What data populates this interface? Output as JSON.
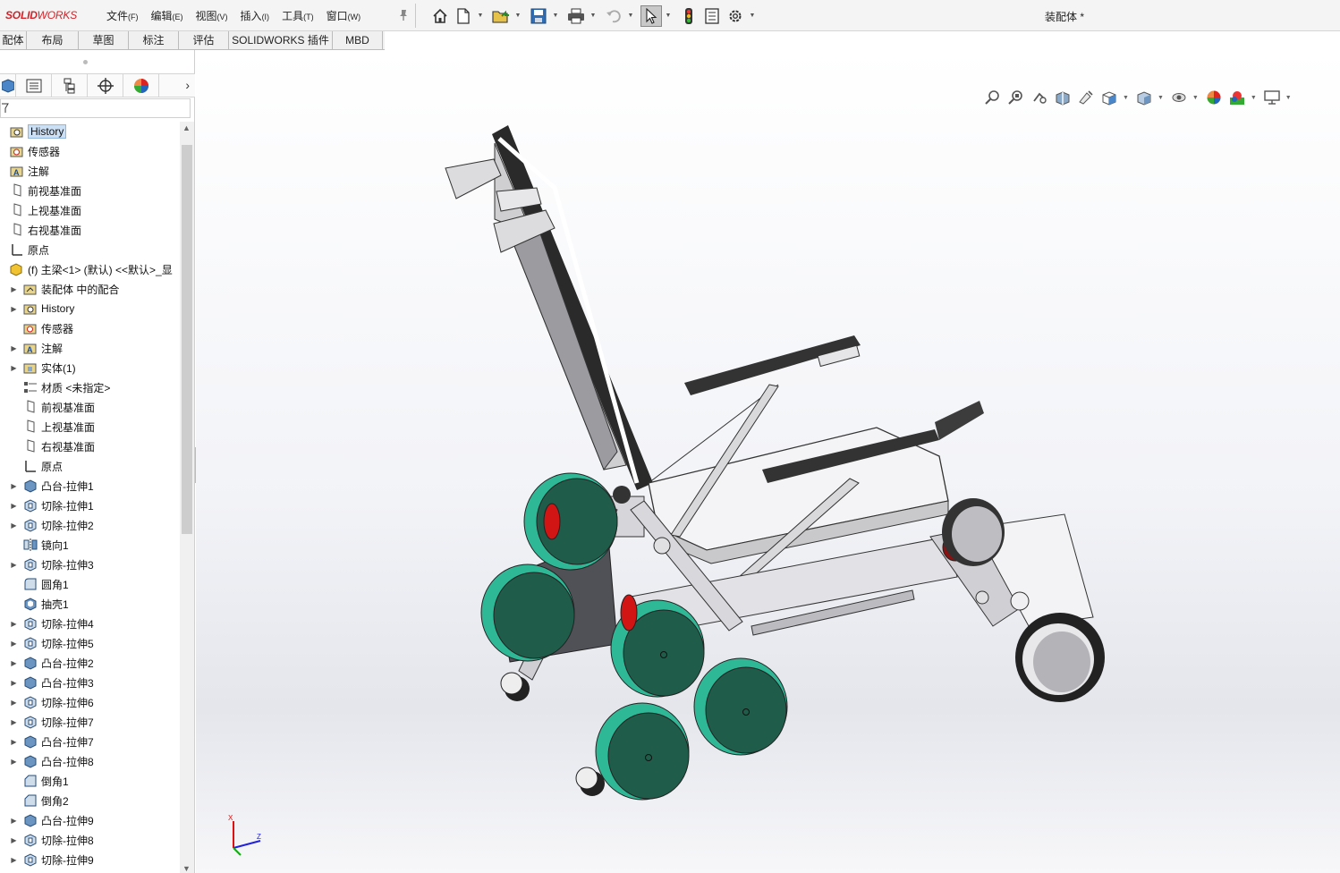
{
  "app": {
    "logo_solid": "SOLID",
    "logo_works": "WORKS",
    "document_title": "装配体 *"
  },
  "menus": [
    {
      "label": "文件",
      "key": "(F)"
    },
    {
      "label": "编辑",
      "key": "(E)"
    },
    {
      "label": "视图",
      "key": "(V)"
    },
    {
      "label": "插入",
      "key": "(I)"
    },
    {
      "label": "工具",
      "key": "(T)"
    },
    {
      "label": "窗口",
      "key": "(W)"
    }
  ],
  "quick_access_icons": [
    "home-icon",
    "new-document-icon",
    "open-icon",
    "save-icon",
    "print-icon",
    "undo-icon",
    "select-icon",
    "rebuild-icon",
    "file-properties-icon",
    "options-icon"
  ],
  "command_tabs": [
    "配体",
    "布局",
    "草图",
    "标注",
    "评估",
    "SOLIDWORKS 插件",
    "MBD"
  ],
  "panel_tabs": [
    "feature-manager-icon",
    "property-manager-icon",
    "configuration-manager-icon",
    "dimxpert-icon",
    "display-manager-icon"
  ],
  "tree": [
    {
      "label": "History",
      "icon": "history-icon",
      "level": 0,
      "expand": false,
      "selected": true
    },
    {
      "label": "传感器",
      "icon": "sensor-icon",
      "level": 0,
      "expand": false
    },
    {
      "label": "注解",
      "icon": "annotation-icon",
      "level": 0,
      "expand": false
    },
    {
      "label": "前视基准面",
      "icon": "plane-icon",
      "level": 0,
      "expand": false
    },
    {
      "label": "上视基准面",
      "icon": "plane-icon",
      "level": 0,
      "expand": false
    },
    {
      "label": "右视基准面",
      "icon": "plane-icon",
      "level": 0,
      "expand": false
    },
    {
      "label": "原点",
      "icon": "origin-icon",
      "level": 0,
      "expand": false
    },
    {
      "label": "(f) 主梁<1> (默认) <<默认>_显",
      "icon": "part-icon",
      "level": 0,
      "expand": false
    },
    {
      "label": "装配体 中的配合",
      "icon": "mates-icon",
      "level": 1,
      "expand": true
    },
    {
      "label": "History",
      "icon": "history-icon",
      "level": 1,
      "expand": true
    },
    {
      "label": "传感器",
      "icon": "sensor-icon",
      "level": 1,
      "expand": false
    },
    {
      "label": "注解",
      "icon": "annotation-icon",
      "level": 1,
      "expand": true
    },
    {
      "label": "实体(1)",
      "icon": "solid-bodies-icon",
      "level": 1,
      "expand": true
    },
    {
      "label": "材质 <未指定>",
      "icon": "material-icon",
      "level": 1,
      "expand": false
    },
    {
      "label": "前视基准面",
      "icon": "plane-icon",
      "level": 1,
      "expand": false
    },
    {
      "label": "上视基准面",
      "icon": "plane-icon",
      "level": 1,
      "expand": false
    },
    {
      "label": "右视基准面",
      "icon": "plane-icon",
      "level": 1,
      "expand": false
    },
    {
      "label": "原点",
      "icon": "origin-icon",
      "level": 1,
      "expand": false
    },
    {
      "label": "凸台-拉伸1",
      "icon": "boss-extrude-icon",
      "level": 1,
      "expand": true
    },
    {
      "label": "切除-拉伸1",
      "icon": "cut-extrude-icon",
      "level": 1,
      "expand": true
    },
    {
      "label": "切除-拉伸2",
      "icon": "cut-extrude-icon",
      "level": 1,
      "expand": true
    },
    {
      "label": "镜向1",
      "icon": "mirror-icon",
      "level": 1,
      "expand": false
    },
    {
      "label": "切除-拉伸3",
      "icon": "cut-extrude-icon",
      "level": 1,
      "expand": true
    },
    {
      "label": "圆角1",
      "icon": "fillet-icon",
      "level": 1,
      "expand": false
    },
    {
      "label": "抽壳1",
      "icon": "shell-icon",
      "level": 1,
      "expand": false
    },
    {
      "label": "切除-拉伸4",
      "icon": "cut-extrude-icon",
      "level": 1,
      "expand": true
    },
    {
      "label": "切除-拉伸5",
      "icon": "cut-extrude-icon",
      "level": 1,
      "expand": true
    },
    {
      "label": "凸台-拉伸2",
      "icon": "boss-extrude-icon",
      "level": 1,
      "expand": true
    },
    {
      "label": "凸台-拉伸3",
      "icon": "boss-extrude-icon",
      "level": 1,
      "expand": true
    },
    {
      "label": "切除-拉伸6",
      "icon": "cut-extrude-icon",
      "level": 1,
      "expand": true
    },
    {
      "label": "切除-拉伸7",
      "icon": "cut-extrude-icon",
      "level": 1,
      "expand": true
    },
    {
      "label": "凸台-拉伸7",
      "icon": "boss-extrude-icon",
      "level": 1,
      "expand": true
    },
    {
      "label": "凸台-拉伸8",
      "icon": "boss-extrude-icon",
      "level": 1,
      "expand": true
    },
    {
      "label": "倒角1",
      "icon": "chamfer-icon",
      "level": 1,
      "expand": false
    },
    {
      "label": "倒角2",
      "icon": "chamfer-icon",
      "level": 1,
      "expand": false
    },
    {
      "label": "凸台-拉伸9",
      "icon": "boss-extrude-icon",
      "level": 1,
      "expand": true
    },
    {
      "label": "切除-拉伸8",
      "icon": "cut-extrude-icon",
      "level": 1,
      "expand": true
    },
    {
      "label": "切除-拉伸9",
      "icon": "cut-extrude-icon",
      "level": 1,
      "expand": true
    }
  ],
  "heads_up_icons": [
    "zoom-to-fit-icon",
    "zoom-to-area-icon",
    "previous-view-icon",
    "section-view-icon",
    "dynamic-annotation-icon",
    "view-orientation-icon",
    "display-style-icon",
    "hide-show-icon",
    "edit-appearance-icon",
    "apply-scene-icon",
    "view-settings-icon"
  ],
  "triad": {
    "x_label": "X",
    "z_label": "Z"
  },
  "colors": {
    "wheel_teal": "#2fb896",
    "wheel_face": "#1f5c4a",
    "accent_red": "#d11414",
    "frame": "#d9d9dc",
    "armrest": "#3c3c3c"
  }
}
